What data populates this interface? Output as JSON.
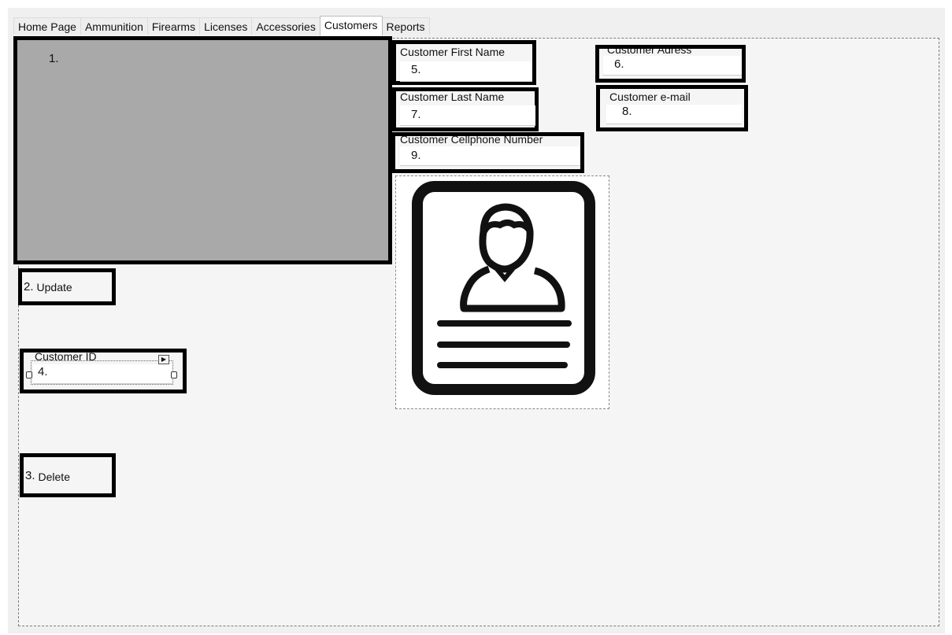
{
  "tabs": [
    {
      "label": "Home Page"
    },
    {
      "label": "Ammunition"
    },
    {
      "label": "Firearms"
    },
    {
      "label": "Licenses"
    },
    {
      "label": "Accessories"
    },
    {
      "label": "Customers",
      "active": true
    },
    {
      "label": "Reports"
    }
  ],
  "grid": {
    "number": "1."
  },
  "update_button": {
    "number": "2.",
    "label": "Update"
  },
  "delete_button": {
    "number": "3.",
    "label": "Delete"
  },
  "customer_id": {
    "label": "Customer ID",
    "number": "4."
  },
  "first_name": {
    "label": "Customer First Name",
    "number": "5."
  },
  "address": {
    "label": "Customer Adress",
    "number": "6."
  },
  "last_name": {
    "label": "Customer Last Name",
    "number": "7."
  },
  "email": {
    "label": "Customer e-mail",
    "number": "8."
  },
  "cellphone": {
    "label": "Customer Cellphone Number",
    "number": "9."
  },
  "picture": {
    "icon": "customer-profile-card-icon"
  }
}
